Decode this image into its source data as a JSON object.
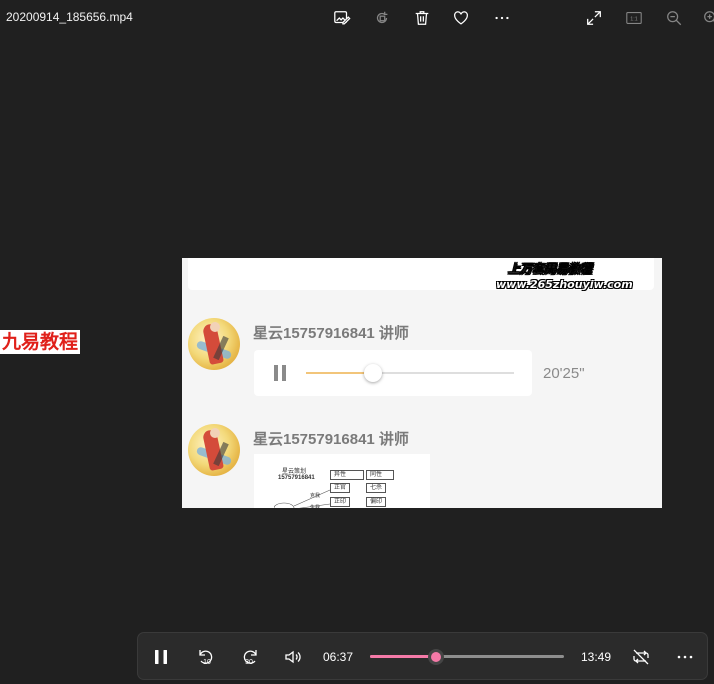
{
  "title_bar": {
    "filename": "20200914_185656.mp4",
    "icons": [
      "edit-image-icon",
      "rotate-icon",
      "delete-icon",
      "favorite-icon",
      "more-options-icon",
      "expand-icon",
      "actual-size-icon",
      "zoom-out-icon",
      "zoom-in-icon"
    ]
  },
  "overlay": {
    "left_watermark": "九易教程",
    "right_watermark_line1": "上万套周易教程",
    "right_watermark_line2": "www.265zhouyiw.com"
  },
  "video_frame": {
    "messages": [
      {
        "sender": "星云15757916841 讲师",
        "type": "audio",
        "duration": "20'25\"",
        "progress": 0.32
      },
      {
        "sender": "星云15757916841 讲师",
        "type": "image"
      }
    ],
    "doc_thumbnail": {
      "line1": "星云策划",
      "line2": "15757916841",
      "box1": "异性",
      "box2": "同性",
      "box3": "正官",
      "box4": "七杀",
      "box5": "正印",
      "box6": "偏印",
      "small1": "克我",
      "small2": "生我"
    }
  },
  "player": {
    "current_time": "06:37",
    "total_time": "13:49",
    "progress": 0.34,
    "rewind_label": "10",
    "forward_label": "30",
    "accent_color": "#f57aa8"
  }
}
